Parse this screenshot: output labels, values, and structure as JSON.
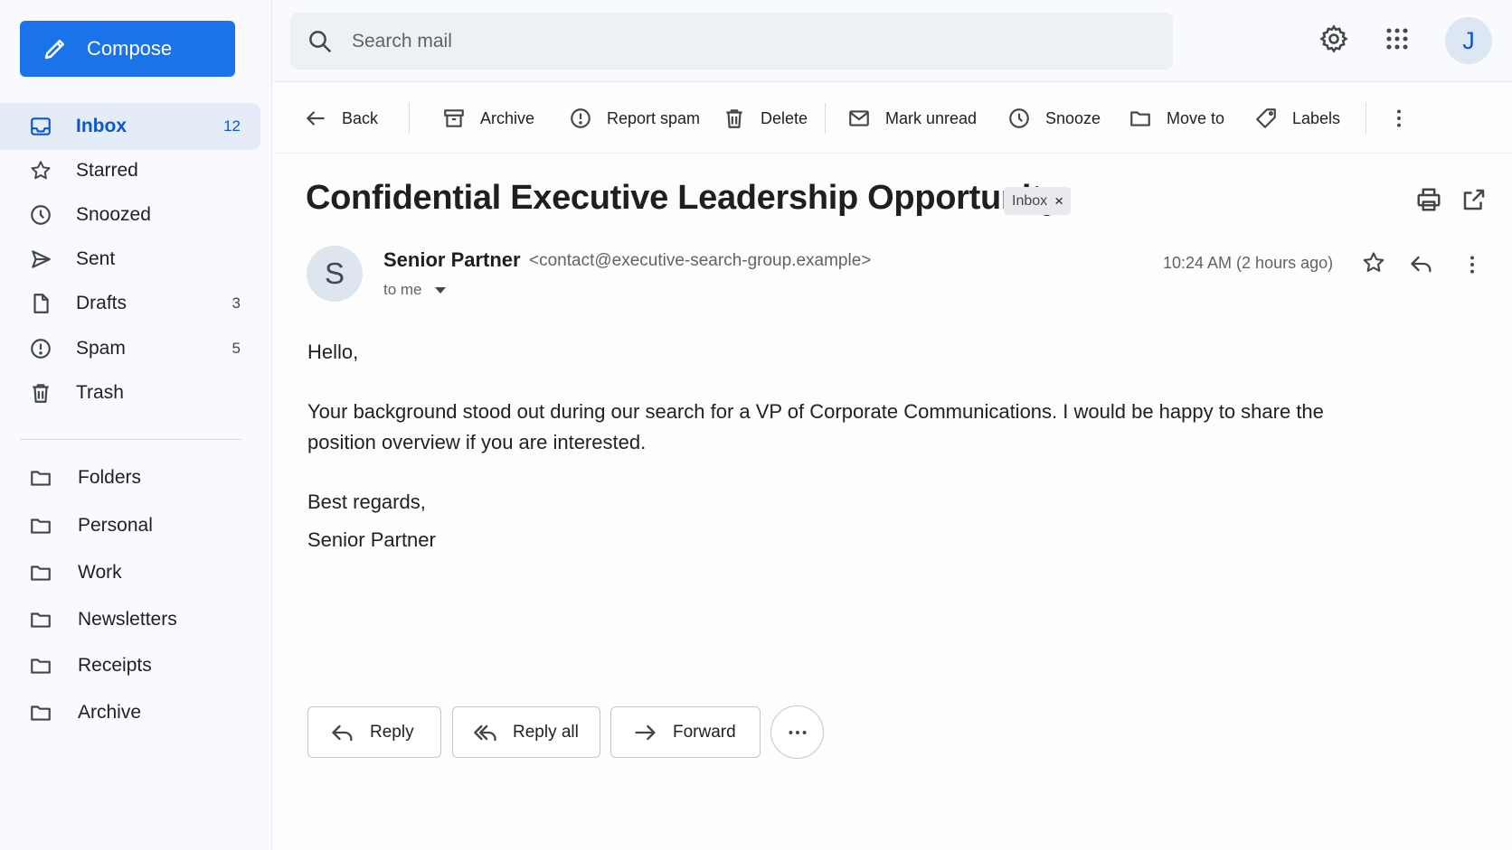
{
  "sidebar": {
    "compose_label": "Compose",
    "items": [
      {
        "label": "Inbox",
        "count": "12",
        "icon": "inbox-icon"
      },
      {
        "label": "Starred",
        "count": "",
        "icon": "star-icon"
      },
      {
        "label": "Snoozed",
        "count": "",
        "icon": "clock-icon"
      },
      {
        "label": "Sent",
        "count": "",
        "icon": "send-icon"
      },
      {
        "label": "Drafts",
        "count": "3",
        "icon": "file-icon"
      },
      {
        "label": "Spam",
        "count": "5",
        "icon": "alert-icon"
      },
      {
        "label": "Trash",
        "count": "",
        "icon": "trash-icon"
      }
    ],
    "folders": [
      {
        "label": "Folders",
        "icon": "folder-icon"
      },
      {
        "label": "Personal",
        "icon": "folder-icon"
      },
      {
        "label": "Work",
        "icon": "folder-icon"
      },
      {
        "label": "Newsletters",
        "icon": "folder-icon"
      },
      {
        "label": "Receipts",
        "icon": "folder-icon"
      },
      {
        "label": "Archive",
        "icon": "folder-icon"
      }
    ]
  },
  "topbar": {
    "search_placeholder": "Search mail",
    "avatar_initial": "J"
  },
  "toolbar": {
    "back": "Back",
    "archive": "Archive",
    "report_spam": "Report spam",
    "delete": "Delete",
    "mark_unread": "Mark unread",
    "snooze": "Snooze",
    "move_to": "Move to",
    "labels": "Labels"
  },
  "message": {
    "subject": "Confidential Executive Leadership Opportunity",
    "label_chip": "Inbox",
    "sender_initial": "S",
    "sender_name": "Senior Partner",
    "sender_email": "<contact@executive-search-group.example>",
    "recipient": "to me",
    "timestamp": "10:24 AM (2 hours ago)",
    "greeting": "Hello,",
    "paragraph_line1": "Your background stood out during our search for a VP of Corporate Communications. I would be happy to share the",
    "paragraph_line2": "position overview if you are interested.",
    "signoff": "Best regards,",
    "signature": "Senior Partner"
  },
  "actions": {
    "reply": "Reply",
    "reply_all": "Reply all",
    "forward": "Forward"
  },
  "colors": {
    "accent": "#1a73e8",
    "active_nav_bg": "#e4ecf7",
    "active_nav_text": "#0b57d0"
  }
}
